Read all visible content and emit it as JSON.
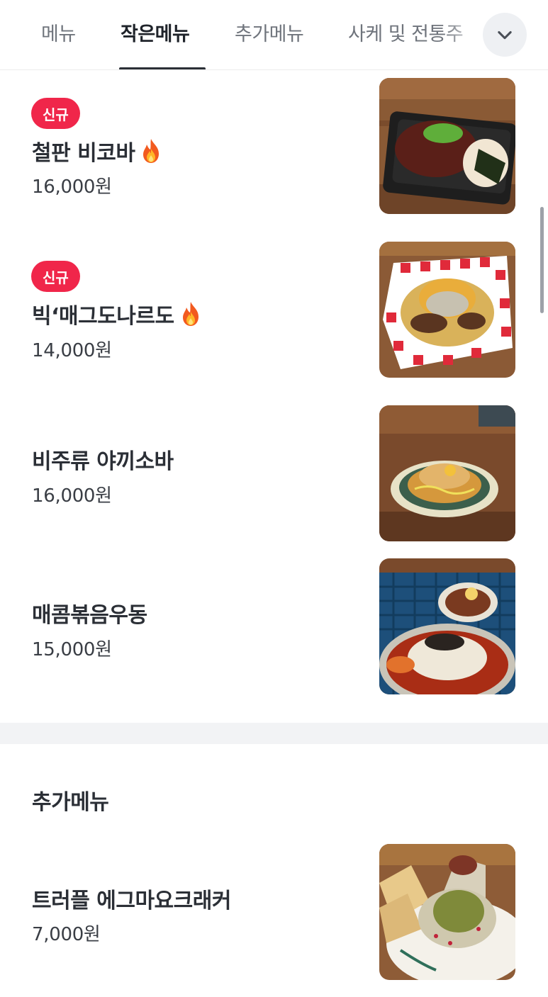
{
  "tabs": [
    {
      "label": "메뉴",
      "active": false
    },
    {
      "label": "작은메뉴",
      "active": true
    },
    {
      "label": "추가메뉴",
      "active": false
    },
    {
      "label": "사케 및 전통주",
      "active": false
    }
  ],
  "expand_icon": "chevron-down-icon",
  "small_menu": {
    "items": [
      {
        "badge": "신규",
        "name": "철판 비코바",
        "hot": true,
        "price": "16,000원",
        "image": "iron-plate-dish"
      },
      {
        "badge": "신규",
        "name": "빅‘매그도나르도",
        "hot": true,
        "price": "14,000원",
        "image": "fries-dish"
      },
      {
        "badge": "",
        "name": "비주류 야끼소바",
        "hot": false,
        "price": "16,000원",
        "image": "yakisoba-dish"
      },
      {
        "badge": "",
        "name": "매콤볶음우동",
        "hot": false,
        "price": "15,000원",
        "image": "udon-dish"
      }
    ]
  },
  "extra_menu": {
    "title": "추가메뉴",
    "items": [
      {
        "name": "트러플 에그마요크래커",
        "price": "7,000원",
        "image": "cracker-dish"
      }
    ]
  },
  "colors": {
    "badge": "#f0264a",
    "active_tab": "#1f232a",
    "inactive_tab": "#6f747c",
    "divider": "#f2f3f5"
  }
}
